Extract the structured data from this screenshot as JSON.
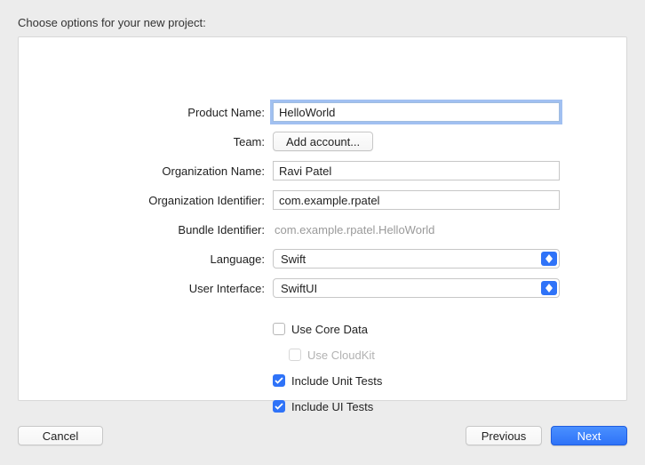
{
  "heading": "Choose options for your new project:",
  "labels": {
    "product_name": "Product Name:",
    "team": "Team:",
    "org_name": "Organization Name:",
    "org_id": "Organization Identifier:",
    "bundle_id": "Bundle Identifier:",
    "language": "Language:",
    "ui": "User Interface:"
  },
  "values": {
    "product_name": "HelloWorld",
    "team_button": "Add account...",
    "org_name": "Ravi Patel",
    "org_id": "com.example.rpatel",
    "bundle_id": "com.example.rpatel.HelloWorld",
    "language": "Swift",
    "ui": "SwiftUI"
  },
  "checkboxes": {
    "core_data": {
      "label": "Use Core Data",
      "checked": false,
      "disabled": false
    },
    "cloudkit": {
      "label": "Use CloudKit",
      "checked": false,
      "disabled": true
    },
    "unit_tests": {
      "label": "Include Unit Tests",
      "checked": true,
      "disabled": false
    },
    "ui_tests": {
      "label": "Include UI Tests",
      "checked": true,
      "disabled": false
    }
  },
  "buttons": {
    "cancel": "Cancel",
    "previous": "Previous",
    "next": "Next"
  }
}
